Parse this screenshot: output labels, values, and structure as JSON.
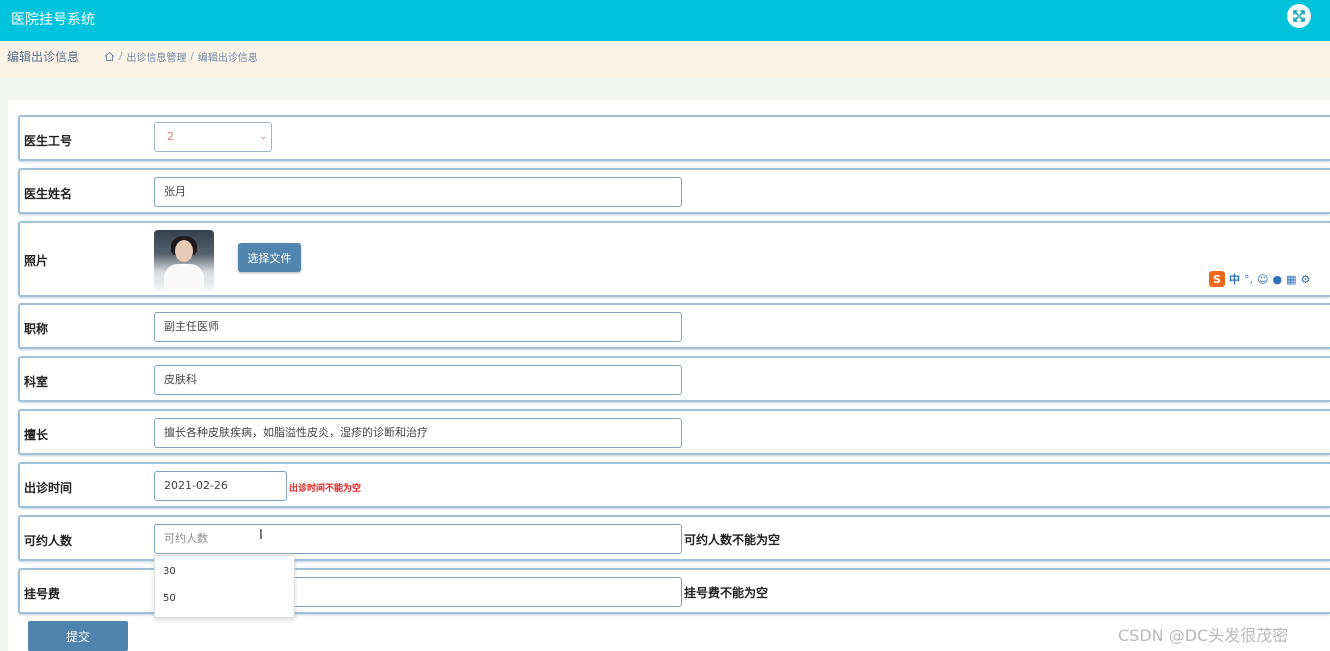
{
  "app": {
    "title": "医院挂号系统"
  },
  "header": {
    "close_icon": "close-x-icon"
  },
  "breadcrumb": {
    "page_title": "编辑出诊信息",
    "home_icon": "home-icon",
    "items": [
      "出诊信息管理",
      "编辑出诊信息"
    ],
    "separator": "/"
  },
  "form": {
    "doctor_id": {
      "label": "医生工号",
      "value": "2"
    },
    "doctor_name": {
      "label": "医生姓名",
      "value": "张月"
    },
    "photo": {
      "label": "照片",
      "button_label": "选择文件"
    },
    "title": {
      "label": "职称",
      "value": "副主任医师"
    },
    "department": {
      "label": "科室",
      "value": "皮肤科"
    },
    "specialty": {
      "label": "擅长",
      "value": "擅长各种皮肤疾病，如脂溢性皮炎，湿疹的诊断和治疗"
    },
    "visit_time": {
      "label": "出诊时间",
      "value": "2021-02-26",
      "error": "出诊时间不能为空"
    },
    "capacity": {
      "label": "可约人数",
      "placeholder": "可约人数",
      "error": "可约人数不能为空",
      "suggestions": [
        "30",
        "50"
      ]
    },
    "fee": {
      "label": "挂号费",
      "value": "",
      "error": "挂号费不能为空"
    },
    "submit_label": "提交"
  },
  "ime": {
    "logo": "S",
    "mode": "中"
  },
  "watermark": "CSDN @DC头发很茂密",
  "colors": {
    "topbar": "#01c4dc",
    "crumbbar": "#fcf3e7",
    "button": "#5286ae",
    "error": "#e02020"
  }
}
